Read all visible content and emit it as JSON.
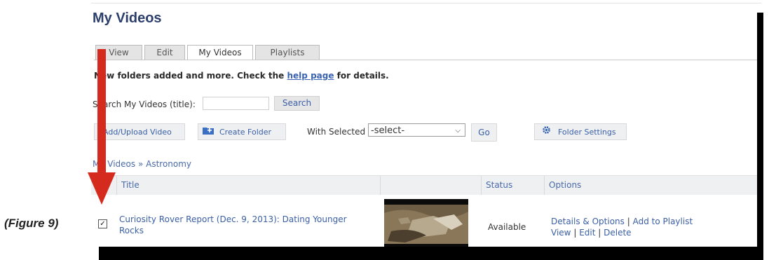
{
  "figure_label": "(Figure 9)",
  "page": {
    "title": "My Videos",
    "tabs": [
      "View",
      "Edit",
      "My Videos",
      "Playlists"
    ],
    "active_tab": "My Videos",
    "notice_prefix": "New folders added and more. Check the",
    "notice_link": "help page",
    "notice_suffix": "for details."
  },
  "search": {
    "label": "Search My Videos (title):",
    "value": "",
    "button": "Search"
  },
  "toolbar": {
    "add_upload": "Add/Upload Video",
    "create_folder": "Create Folder",
    "with_selected": "With Selected",
    "select_value": "-select-",
    "go": "Go",
    "folder_settings": "Folder Settings"
  },
  "breadcrumb": "My Videos » Astronomy",
  "table": {
    "headers": [
      "Title",
      "",
      "Status",
      "Options"
    ],
    "rows": [
      {
        "checked": true,
        "title": "Curiosity Rover Report (Dec. 9, 2013): Dating Younger Rocks",
        "status": "Available",
        "options_line1": [
          "Details & Options",
          "Add to Playlist"
        ],
        "options_line2": [
          "View",
          "Edit",
          "Delete"
        ]
      }
    ]
  },
  "colors": {
    "link": "#3a5fa6",
    "title": "#2c3e6b",
    "arrow": "#d52b1e"
  }
}
